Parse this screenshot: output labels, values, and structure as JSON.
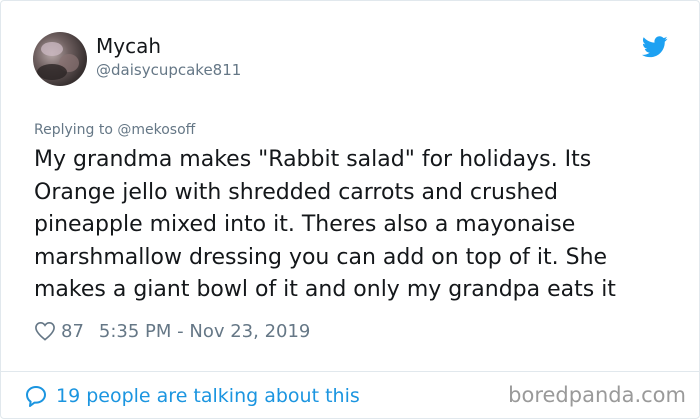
{
  "user": {
    "display_name": "Mycah",
    "handle": "@daisycupcake811"
  },
  "tweet": {
    "replying_to": "Replying to @mekosoff",
    "lines": [
      "My grandma makes \"Rabbit salad\" for holidays. Its",
      "Orange jello with shredded carrots and crushed",
      "pineapple mixed into it. Theres also a mayonaise",
      "marshmallow dressing you can add on top of it. She",
      "makes a giant bowl of it and only my grandpa eats it"
    ],
    "like_count": "87",
    "timestamp": "5:35 PM - Nov 23, 2019"
  },
  "footer": {
    "talking_label": "19 people are talking about this"
  },
  "watermark": "boredpanda.com",
  "icons": {
    "bird": "twitter-bird-icon",
    "heart": "heart-icon",
    "bubble": "speech-bubble-icon"
  },
  "colors": {
    "twitter_blue": "#1da1f2",
    "link_blue": "#1b95e0",
    "muted_gray": "#657786"
  }
}
